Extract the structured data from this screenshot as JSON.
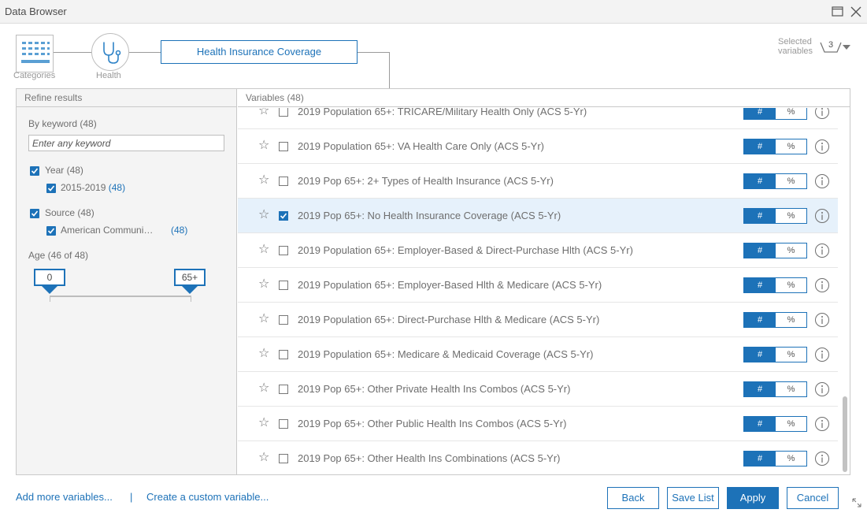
{
  "window": {
    "title": "Data Browser"
  },
  "breadcrumb": {
    "categories_label": "Categories",
    "health_label": "Health",
    "current": "Health Insurance Coverage"
  },
  "selected": {
    "label_line1": "Selected",
    "label_line2": "variables",
    "count": "3"
  },
  "refine": {
    "header": "Refine results",
    "keyword_label": "By keyword (48)",
    "keyword_placeholder": "Enter any keyword",
    "year_label": "Year (48)",
    "year_value": "2015-2019",
    "year_count": "(48)",
    "source_label": "Source (48)",
    "source_value": "American Communi…",
    "source_count": "(48)",
    "age_label": "Age (46 of 48)",
    "age_min": "0",
    "age_max": "65+"
  },
  "variables": {
    "header": "Variables (48)",
    "toggle_num": "#",
    "toggle_pct": "%",
    "rows": [
      {
        "name": "2019 Population 65+: TRICARE/Military Health Only (ACS 5-Yr)",
        "checked": false
      },
      {
        "name": "2019 Population 65+: VA Health Care Only (ACS 5-Yr)",
        "checked": false
      },
      {
        "name": "2019 Pop 65+: 2+ Types of Health Insurance (ACS 5-Yr)",
        "checked": false
      },
      {
        "name": "2019 Pop 65+: No Health Insurance Coverage (ACS 5-Yr)",
        "checked": true
      },
      {
        "name": "2019 Population 65+: Employer-Based & Direct-Purchase Hlth (ACS 5-Yr)",
        "checked": false
      },
      {
        "name": "2019 Population 65+: Employer-Based Hlth & Medicare (ACS 5-Yr)",
        "checked": false
      },
      {
        "name": "2019 Population 65+: Direct-Purchase Hlth & Medicare (ACS 5-Yr)",
        "checked": false
      },
      {
        "name": "2019 Population 65+: Medicare & Medicaid Coverage (ACS 5-Yr)",
        "checked": false
      },
      {
        "name": "2019 Pop 65+: Other Private Health Ins Combos (ACS 5-Yr)",
        "checked": false
      },
      {
        "name": "2019 Pop 65+: Other Public Health Ins Combos (ACS 5-Yr)",
        "checked": false
      },
      {
        "name": "2019 Pop 65+: Other Health Ins Combinations (ACS 5-Yr)",
        "checked": false
      }
    ]
  },
  "footer": {
    "add_more": "Add more variables...",
    "separator": "|",
    "create_custom": "Create a custom variable...",
    "back": "Back",
    "save_list": "Save List",
    "apply": "Apply",
    "cancel": "Cancel"
  },
  "colors": {
    "accent": "#1d72b8",
    "selected_row": "#e6f1fb",
    "pane_bg": "#f4f4f4"
  }
}
